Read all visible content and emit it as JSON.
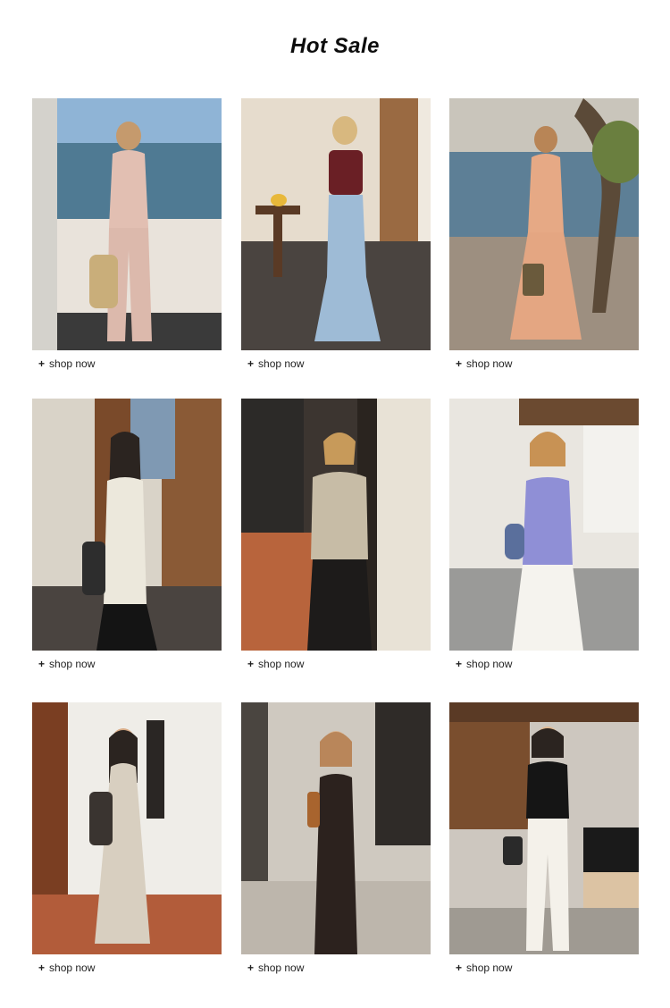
{
  "page": {
    "title": "Hot Sale"
  },
  "products": [
    {
      "cta_plus": "+",
      "cta_label": "shop now"
    },
    {
      "cta_plus": "+",
      "cta_label": "shop now"
    },
    {
      "cta_plus": "+",
      "cta_label": "shop now"
    },
    {
      "cta_plus": "+",
      "cta_label": "shop now"
    },
    {
      "cta_plus": "+",
      "cta_label": "shop now"
    },
    {
      "cta_plus": "+",
      "cta_label": "shop now"
    },
    {
      "cta_plus": "+",
      "cta_label": "shop now"
    },
    {
      "cta_plus": "+",
      "cta_label": "shop now"
    },
    {
      "cta_plus": "+",
      "cta_label": "shop now"
    }
  ]
}
